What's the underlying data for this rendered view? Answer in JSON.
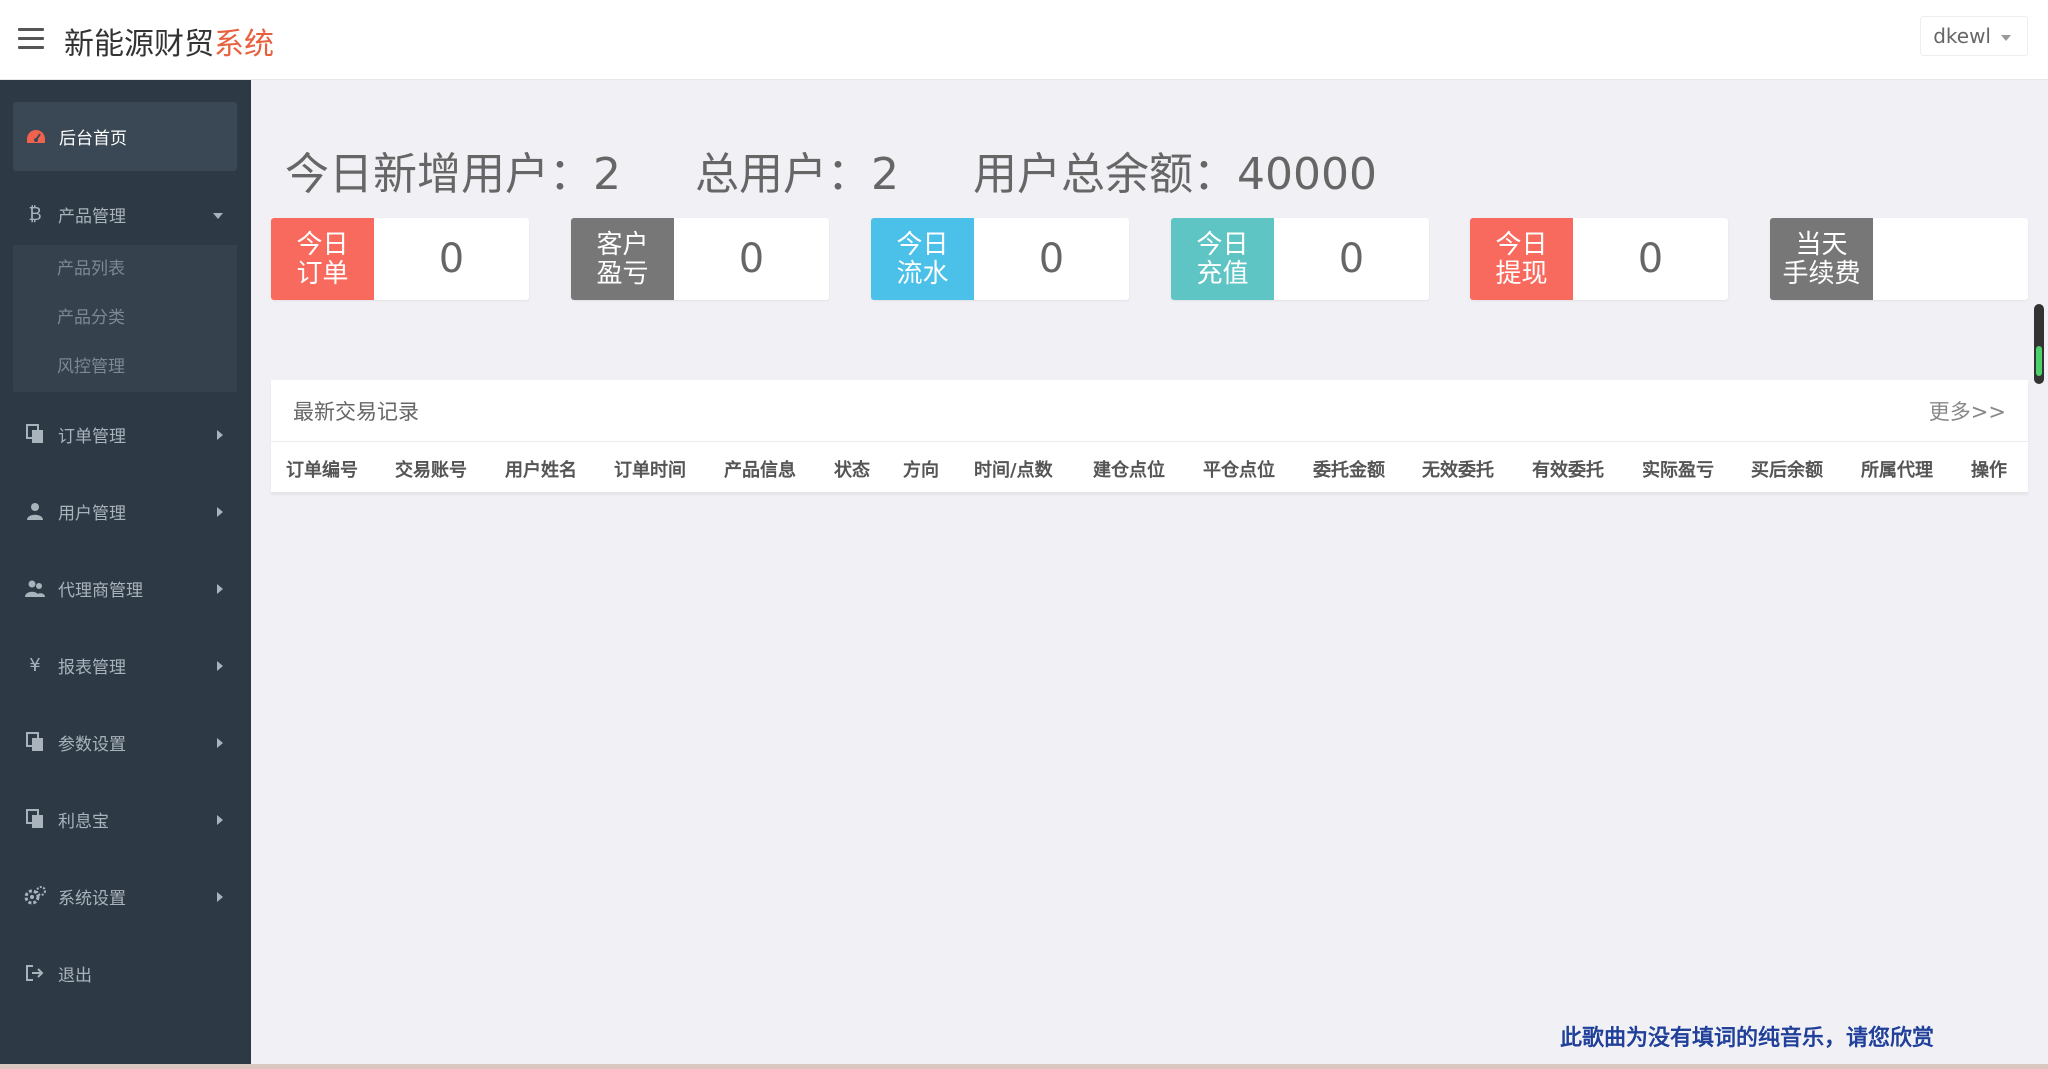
{
  "header": {
    "brand_main": "新能源财贸",
    "brand_accent": "系统",
    "user": "dkewl"
  },
  "sidebar": {
    "home": "后台首页",
    "product": {
      "label": "产品管理",
      "children": [
        "产品列表",
        "产品分类",
        "风控管理"
      ]
    },
    "items": [
      {
        "label": "订单管理",
        "icon": "copy-icon"
      },
      {
        "label": "用户管理",
        "icon": "user-icon"
      },
      {
        "label": "代理商管理",
        "icon": "users-icon"
      },
      {
        "label": "报表管理",
        "icon": "yen-icon"
      },
      {
        "label": "参数设置",
        "icon": "copy-icon"
      },
      {
        "label": "利息宝",
        "icon": "copy-icon"
      },
      {
        "label": "系统设置",
        "icon": "gears-icon"
      }
    ],
    "logout": "退出"
  },
  "stats": {
    "new_users": "今日新增用户：2",
    "total_users": "总用户：2",
    "total_balance": "用户总余额：40000"
  },
  "cards": [
    {
      "label1": "今日",
      "label2": "订单",
      "value": "0",
      "color": "#f96a5e"
    },
    {
      "label1": "客户",
      "label2": "盈亏",
      "value": "0",
      "color": "#777777"
    },
    {
      "label1": "今日",
      "label2": "流水",
      "value": "0",
      "color": "#4bc0e9"
    },
    {
      "label1": "今日",
      "label2": "充值",
      "value": "0",
      "color": "#5fc5c4"
    },
    {
      "label1": "今日",
      "label2": "提现",
      "value": "0",
      "color": "#f96a5e"
    },
    {
      "label1": "当天",
      "label2": "手续费",
      "value": "",
      "color": "#777777"
    }
  ],
  "trades": {
    "title": "最新交易记录",
    "more": "更多>>",
    "columns": [
      "订单编号",
      "交易账号",
      "用户姓名",
      "订单时间",
      "产品信息",
      "状态",
      "方向",
      "时间/点数",
      "建仓点位",
      "平仓点位",
      "委托金额",
      "无效委托",
      "有效委托",
      "实际盈亏",
      "买后余额",
      "所属代理",
      "操作"
    ]
  },
  "overlay": {
    "subtitle": "此歌曲为没有填词的纯音乐，请您欣赏"
  }
}
